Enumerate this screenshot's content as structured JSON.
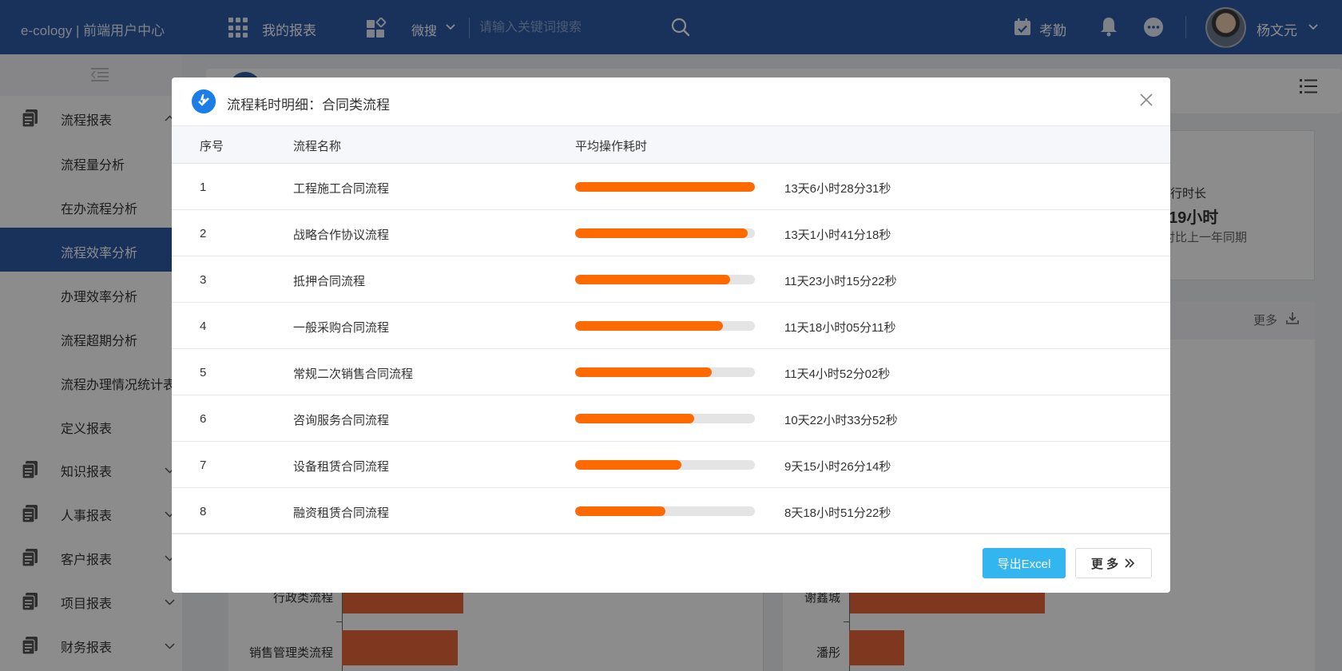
{
  "topbar": {
    "brand": "e-cology | 前端用户中心",
    "apps_icon": "grid-apps-icon",
    "my_reports": "我的报表",
    "widgets_icon": "widgets-icon",
    "search_type": "微搜",
    "search_placeholder": "请输入关键词搜索",
    "attendance_label": "考勤",
    "user_name": "杨文元"
  },
  "sidebar": {
    "items": [
      {
        "label": "流程报表",
        "expanded": true
      },
      {
        "label": "知识报表"
      },
      {
        "label": "人事报表"
      },
      {
        "label": "客户报表"
      },
      {
        "label": "项目报表"
      },
      {
        "label": "财务报表"
      }
    ],
    "sub_items": [
      {
        "label": "流程量分析"
      },
      {
        "label": "在办流程分析"
      },
      {
        "label": "流程效率分析",
        "active": true
      },
      {
        "label": "办理效率分析"
      },
      {
        "label": "流程超期分析"
      },
      {
        "label": "流程办理情况统计表"
      },
      {
        "label": "定义报表"
      }
    ]
  },
  "background": {
    "kpi_label": "行时长",
    "kpi_value": "19小时",
    "kpi_compare": "对比上一年同期",
    "more_link": "更多",
    "left_chart_categories": [
      "行政类流程",
      "销售管理类流程"
    ],
    "right_chart_categories": [
      "谢鑫城",
      "潘彤"
    ]
  },
  "modal": {
    "title": "流程耗时明细：合同类流程",
    "columns": {
      "index": "序号",
      "name": "流程名称",
      "avg_time": "平均操作耗时"
    },
    "rows": [
      {
        "index": "1",
        "name": "工程施工合同流程",
        "progress": 1.0,
        "time": "13天6小时28分31秒"
      },
      {
        "index": "2",
        "name": "战略合作协议流程",
        "progress": 0.96,
        "time": "13天1小时41分18秒"
      },
      {
        "index": "3",
        "name": "抵押合同流程",
        "progress": 0.86,
        "time": "11天23小时15分22秒"
      },
      {
        "index": "4",
        "name": "一般采购合同流程",
        "progress": 0.82,
        "time": "11天18小时05分11秒"
      },
      {
        "index": "5",
        "name": "常规二次销售合同流程",
        "progress": 0.76,
        "time": "11天4小时52分02秒"
      },
      {
        "index": "6",
        "name": "咨询服务合同流程",
        "progress": 0.66,
        "time": "10天22小时33分52秒"
      },
      {
        "index": "7",
        "name": "设备租赁合同流程",
        "progress": 0.59,
        "time": "9天15小时26分14秒"
      },
      {
        "index": "8",
        "name": "融资租赁合同流程",
        "progress": 0.5,
        "time": "8天18小时51分22秒"
      }
    ],
    "export_label": "导出Excel",
    "more_label": "更 多"
  },
  "colors": {
    "brand_blue": "#2c5ba8",
    "bar_orange": "#ff6a00",
    "export_blue": "#33b5f0",
    "chart_bar": "#e8673a"
  }
}
